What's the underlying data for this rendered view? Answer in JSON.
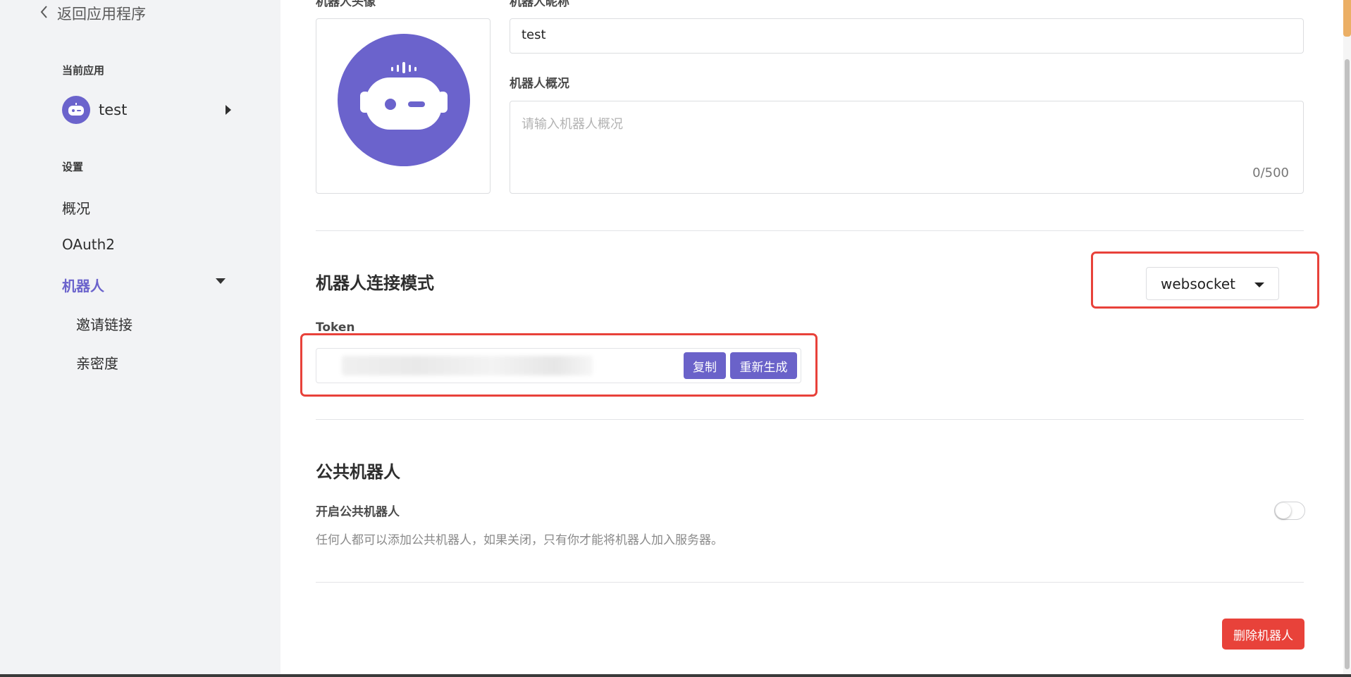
{
  "sidebar": {
    "back_label": "返回应用程序",
    "current_app_label": "当前应用",
    "app_name": "test",
    "settings_label": "设置",
    "nav": [
      {
        "label": "概况"
      },
      {
        "label": "OAuth2"
      },
      {
        "label": "机器人"
      },
      {
        "label": "邀请链接"
      },
      {
        "label": "亲密度"
      }
    ]
  },
  "profile": {
    "avatar_label": "机器人头像",
    "name_label": "机器人昵称",
    "name_value": "test",
    "summary_label": "机器人概况",
    "summary_placeholder": "请输入机器人概况",
    "summary_counter": "0/500"
  },
  "connection": {
    "title": "机器人连接模式",
    "mode_value": "websocket",
    "token_label": "Token",
    "copy_label": "复制",
    "regen_label": "重新生成"
  },
  "public_bot": {
    "title": "公共机器人",
    "toggle_label": "开启公共机器人",
    "description": "任何人都可以添加公共机器人，如果关闭，只有你才能将机器人加入服务器。",
    "enabled": false
  },
  "actions": {
    "delete_label": "删除机器人"
  },
  "colors": {
    "accent": "#6b63cc",
    "danger": "#e8423a",
    "sidebar_bg": "#f2f3f5"
  }
}
